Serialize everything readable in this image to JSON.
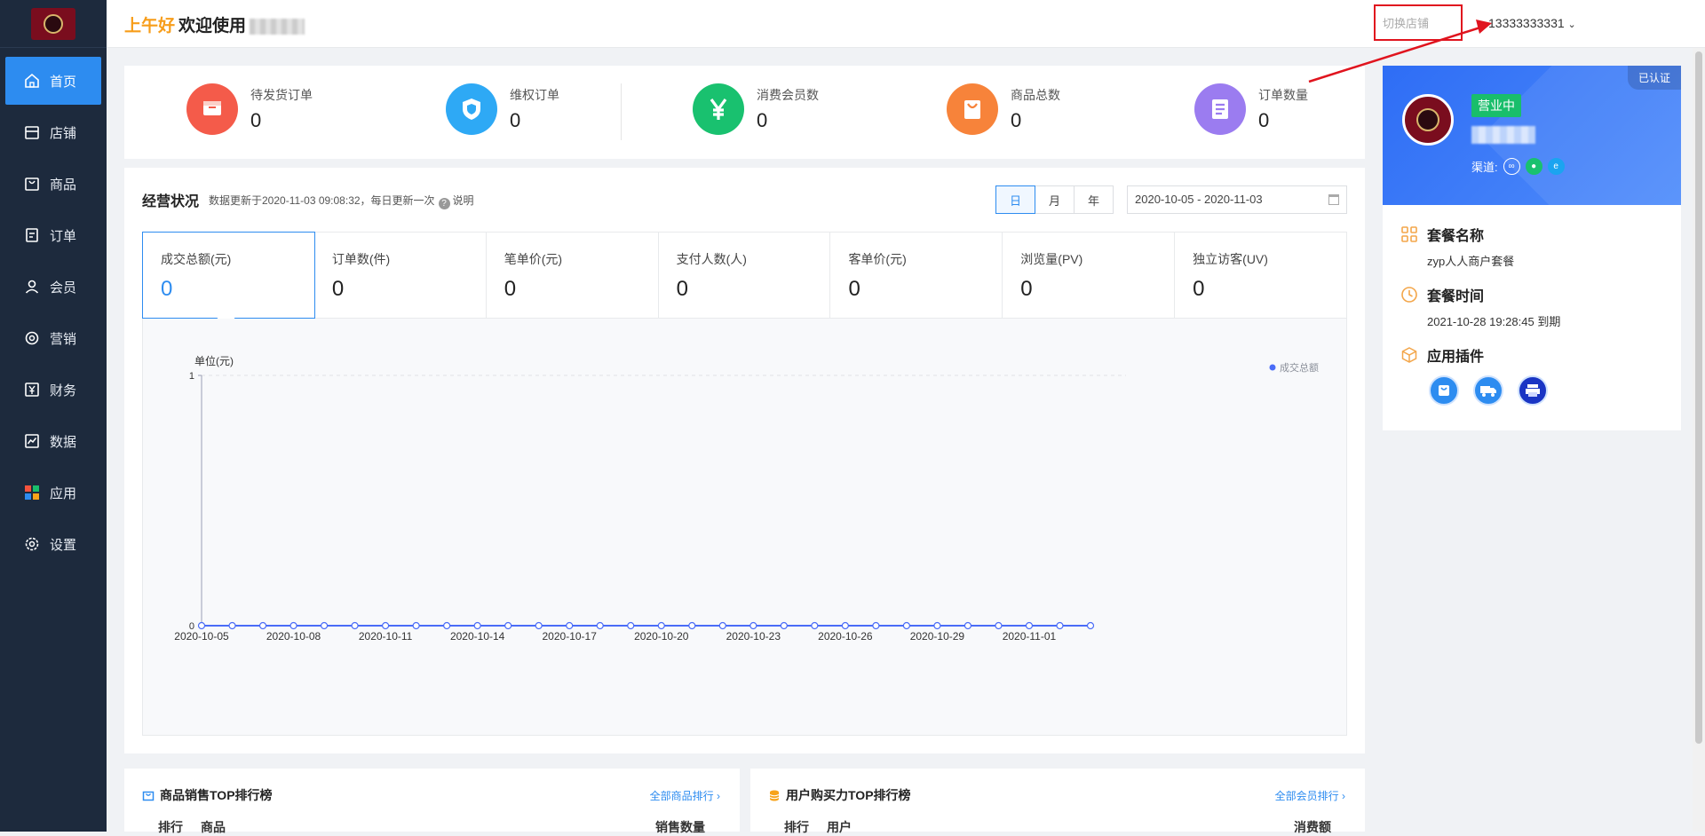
{
  "header": {
    "greeting_am": "上午好",
    "greeting_welcome": "欢迎使用",
    "switch_store": "切换店铺",
    "user": "13333333331"
  },
  "nav": [
    {
      "label": "首页",
      "icon": "home-icon",
      "active": true
    },
    {
      "label": "店铺",
      "icon": "store-icon"
    },
    {
      "label": "商品",
      "icon": "bag-icon"
    },
    {
      "label": "订单",
      "icon": "order-icon"
    },
    {
      "label": "会员",
      "icon": "user-icon"
    },
    {
      "label": "营销",
      "icon": "marketing-icon"
    },
    {
      "label": "财务",
      "icon": "finance-icon"
    },
    {
      "label": "数据",
      "icon": "chart-icon"
    },
    {
      "label": "应用",
      "icon": "apps-icon"
    },
    {
      "label": "设置",
      "icon": "gear-icon"
    }
  ],
  "stats": [
    {
      "label": "待发货订单",
      "value": "0",
      "icon": "shipping-icon",
      "color": "#f45b4a"
    },
    {
      "label": "维权订单",
      "value": "0",
      "icon": "shield-icon",
      "color": "#2ea9f5"
    },
    {
      "label": "消费会员数",
      "value": "0",
      "icon": "yen-icon",
      "color": "#19c16f"
    },
    {
      "label": "商品总数",
      "value": "0",
      "icon": "bag-icon",
      "color": "#f7833a"
    },
    {
      "label": "订单数量",
      "value": "0",
      "icon": "list-icon",
      "color": "#9b7cf0"
    }
  ],
  "business": {
    "title": "经营状况",
    "note": "数据更新于2020-11-03 09:08:32，每日更新一次",
    "note_help": "说明",
    "periods": [
      "日",
      "月",
      "年"
    ],
    "active_period": "日",
    "date_range": "2020-10-05 - 2020-11-03",
    "metrics": [
      {
        "label": "成交总额(元)",
        "value": "0"
      },
      {
        "label": "订单数(件)",
        "value": "0"
      },
      {
        "label": "笔单价(元)",
        "value": "0"
      },
      {
        "label": "支付人数(人)",
        "value": "0"
      },
      {
        "label": "客单价(元)",
        "value": "0"
      },
      {
        "label": "浏览量(PV)",
        "value": "0"
      },
      {
        "label": "独立访客(UV)",
        "value": "0"
      }
    ]
  },
  "chart_data": {
    "type": "line",
    "ylabel": "单位(元)",
    "ylim": [
      0,
      1
    ],
    "yticks": [
      "0",
      "1"
    ],
    "legend": "top-right",
    "series": [
      {
        "name": "成交总额",
        "color": "#4a6cf7",
        "values": [
          0,
          0,
          0,
          0,
          0,
          0,
          0,
          0,
          0,
          0,
          0,
          0,
          0,
          0,
          0,
          0,
          0,
          0,
          0,
          0,
          0,
          0,
          0,
          0,
          0,
          0,
          0,
          0,
          0,
          0
        ]
      }
    ],
    "x": [
      "2020-10-05",
      "2020-10-06",
      "2020-10-07",
      "2020-10-08",
      "2020-10-09",
      "2020-10-10",
      "2020-10-11",
      "2020-10-12",
      "2020-10-13",
      "2020-10-14",
      "2020-10-15",
      "2020-10-16",
      "2020-10-17",
      "2020-10-18",
      "2020-10-19",
      "2020-10-20",
      "2020-10-21",
      "2020-10-22",
      "2020-10-23",
      "2020-10-24",
      "2020-10-25",
      "2020-10-26",
      "2020-10-27",
      "2020-10-28",
      "2020-10-29",
      "2020-10-30",
      "2020-10-31",
      "2020-11-01",
      "2020-11-02",
      "2020-11-03"
    ],
    "xtick_labels": [
      "2020-10-05",
      "2020-10-08",
      "2020-10-11",
      "2020-10-14",
      "2020-10-17",
      "2020-10-20",
      "2020-10-23",
      "2020-10-26",
      "2020-10-29",
      "2020-11-01"
    ],
    "grid": true
  },
  "rank_goods": {
    "title": "商品销售TOP排行榜",
    "more": "全部商品排行 ›",
    "col_rank": "排行",
    "col_item": "商品",
    "col_value": "销售数量"
  },
  "rank_users": {
    "title": "用户购买力TOP排行榜",
    "more": "全部会员排行 ›",
    "col_rank": "排行",
    "col_item": "用户",
    "col_value": "消费额"
  },
  "store": {
    "verified": "已认证",
    "status": "营业中",
    "channel_label": "渠道:",
    "plan_title": "套餐名称",
    "plan_name": "zyp人人商户套餐",
    "time_title": "套餐时间",
    "time_value": "2021-10-28 19:28:45 到期",
    "plugins_title": "应用插件"
  }
}
